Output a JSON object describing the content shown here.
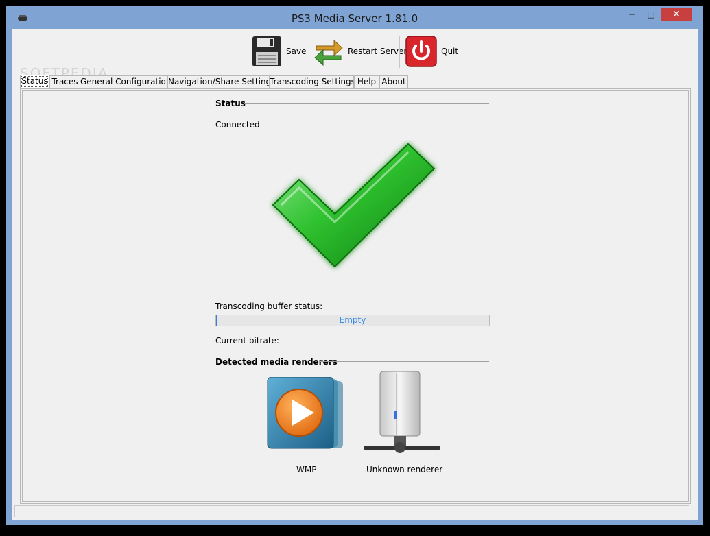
{
  "window": {
    "title": "PS3 Media Server 1.81.0",
    "controls": {
      "minimize": "─",
      "maximize": "□",
      "close": "✕"
    }
  },
  "toolbar": {
    "save_label": "Save",
    "restart_label": "Restart Server",
    "quit_label": "Quit"
  },
  "tabs": [
    {
      "label": "Status",
      "active": true
    },
    {
      "label": "Traces"
    },
    {
      "label": "General Configuration"
    },
    {
      "label": "Navigation/Share Settings"
    },
    {
      "label": "Transcoding Settings"
    },
    {
      "label": "Help"
    },
    {
      "label": "About"
    }
  ],
  "status": {
    "section_title": "Status",
    "connection": "Connected",
    "buffer_label": "Transcoding buffer status:",
    "buffer_text": "Empty",
    "buffer_fraction": 0.005,
    "bitrate_label": "Current bitrate:",
    "renderers_title": "Detected media renderers",
    "renderers": [
      {
        "name": "WMP",
        "icon": "wmp-icon"
      },
      {
        "name": "Unknown renderer",
        "icon": "server-icon"
      }
    ]
  },
  "watermark": "SOFTPEDIA",
  "colors": {
    "accent_green": "#27b427",
    "quit_red": "#d8262c",
    "progress_text": "#3b8ee6"
  }
}
